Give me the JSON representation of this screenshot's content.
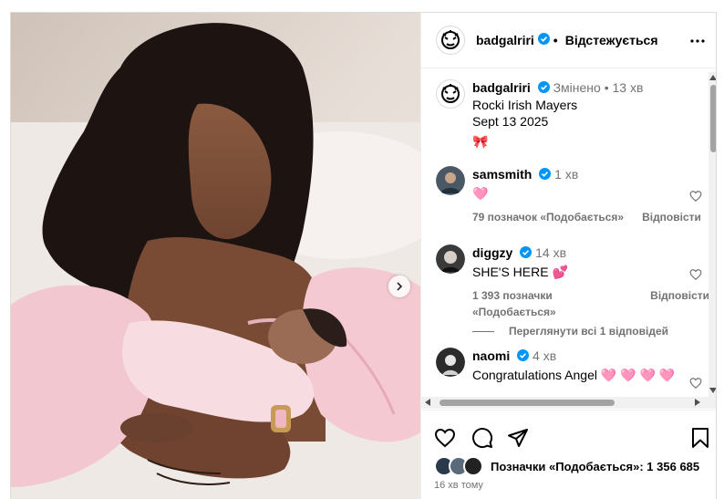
{
  "post": {
    "author": "badgalriri",
    "follow_state": "Відстежується",
    "caption_lines": [
      "Rocki Irish Mayers",
      "Sept 13 2025",
      "🎀"
    ],
    "edited_label": "Змінено",
    "caption_time": "13 хв",
    "separator": "•"
  },
  "comments": [
    {
      "user": "samsmith",
      "time": "1 хв",
      "text": "🩷",
      "likes": "79 позначок «Подобається»",
      "reply": "Відповісти",
      "avatar_color": "#4a5866"
    },
    {
      "user": "diggzy",
      "time": "14 хв",
      "text": "SHE'S HERE 💕",
      "likes": "1 393 позначки «Подобається»",
      "reply": "Відповісти",
      "avatar_color": "#3a3a3a"
    },
    {
      "user": "naomi",
      "time": "4 хв",
      "text": "Congratulations Angel 🩷 🩷 🩷 🩷",
      "avatar_color": "#2b2b2b"
    }
  ],
  "view_replies": "Переглянути всі 1 відповідей",
  "footer": {
    "likes_label": "Позначки «Подобається»: 1 356 685",
    "time_ago": "16 хв тому"
  },
  "icons": {
    "more": "more-options-icon",
    "like": "heart-icon",
    "comment": "comment-icon",
    "share": "share-icon",
    "save": "bookmark-icon",
    "verified": "verified-badge-icon",
    "next": "chevron-right-icon"
  },
  "colors": {
    "verified": "#0095f6",
    "muted": "#737373",
    "border": "#dbdbdb"
  }
}
